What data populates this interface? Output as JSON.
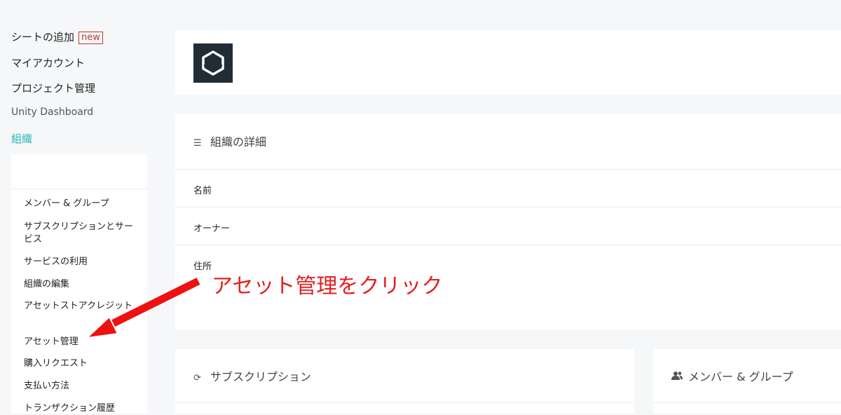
{
  "sidebar": {
    "add_seats": "シートの追加",
    "new_badge": "new",
    "my_account": "マイアカウント",
    "project_management": "プロジェクト管理",
    "dashboard": "Unity Dashboard",
    "organization": "組織",
    "submenu": [
      "メンバー & グループ",
      "サブスクリプションとサービス",
      "サービスの利用",
      "組織の編集",
      "アセットストアクレジット",
      "アセット管理",
      "購入リクエスト",
      "支払い方法",
      "トランザクション履歴"
    ]
  },
  "main": {
    "details_title": "組織の詳細",
    "fields": [
      "名前",
      "オーナー",
      "住所"
    ],
    "subscription_title": "サブスクリプション",
    "members_title": "メンバー & グループ"
  },
  "annotation": {
    "text": "アセット管理をクリック",
    "color": "#e51e1e"
  },
  "colors": {
    "accent": "#2bb5b5",
    "badge": "#c0392b",
    "logo_bg": "#222c37"
  },
  "icons": {
    "logo": "unity-logo-icon",
    "details": "list-icon",
    "subscription": "refresh-icon",
    "members": "people-icon"
  }
}
